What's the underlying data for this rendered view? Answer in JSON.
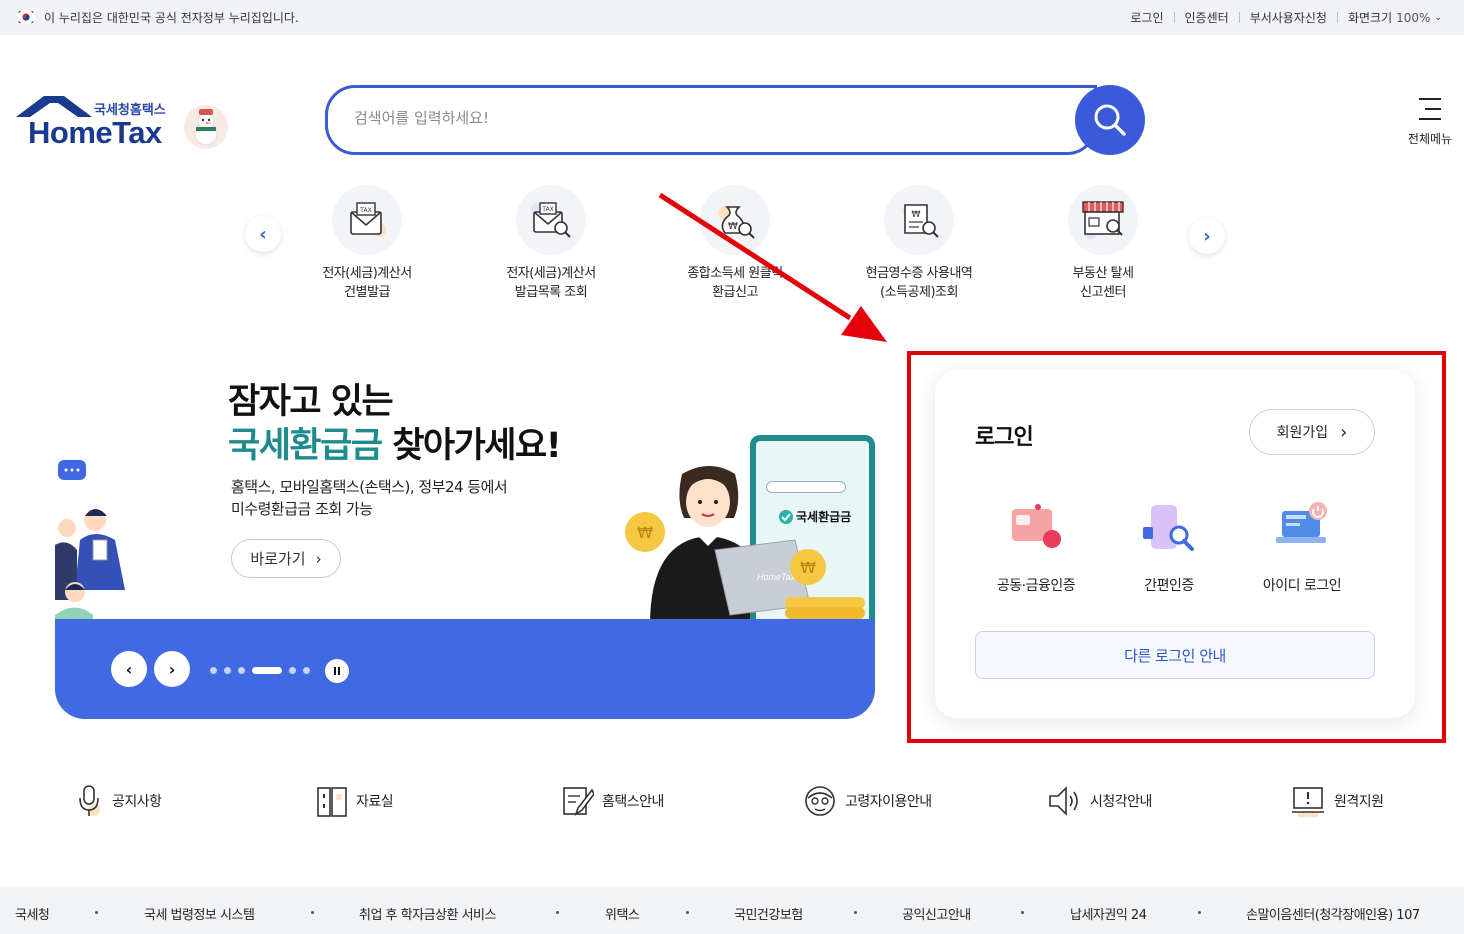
{
  "gov_bar": {
    "notice": "이 누리집은 대한민국 공식 전자정부 누리집입니다.",
    "links": [
      "로그인",
      "인증센터",
      "부서사용자신청"
    ],
    "zoom_label": "화면크기",
    "zoom_value": "100%"
  },
  "header": {
    "logo_sub": "국세청홈택스",
    "logo_main": "HomeTax",
    "search_placeholder": "검색어를 입력하세요!",
    "menu_label": "전체메뉴"
  },
  "quick_menu": {
    "items": [
      {
        "label": "전자(세금)계산서\n건별발급",
        "icon": "tax-invoice-envelope-icon"
      },
      {
        "label": "전자(세금)계산서\n발급목록 조회",
        "icon": "tax-invoice-search-icon"
      },
      {
        "label": "종합소득세 원클릭\n환급신고",
        "icon": "won-bag-search-icon"
      },
      {
        "label": "현금영수증 사용내역\n(소득공제)조회",
        "icon": "receipt-search-icon"
      },
      {
        "label": "부동산 탈세\n신고센터",
        "icon": "store-search-icon"
      }
    ]
  },
  "banner": {
    "title_line1": "잠자고 있는",
    "title_highlight": "국세환급금",
    "title_rest": " 찾아가세요!",
    "desc_line1": "홈택스, 모바일홈택스(손택스), 정부24 등에서",
    "desc_line2": "미수령환급금 조회 가능",
    "go_label": "바로가기",
    "card_label": "국세환급금",
    "slide_count": 6,
    "active_slide": 4,
    "accent": "#4169e1"
  },
  "login": {
    "title": "로그인",
    "signup_label": "회원가입",
    "options": [
      {
        "label": "공동·금융인증",
        "icon": "certificate-card-icon"
      },
      {
        "label": "간편인증",
        "icon": "phone-search-icon"
      },
      {
        "label": "아이디 로그인",
        "icon": "laptop-power-icon"
      }
    ],
    "other_label": "다른 로그인 안내",
    "highlight_color": "#e4020a"
  },
  "util_links": [
    {
      "label": "공지사항",
      "icon": "microphone-icon"
    },
    {
      "label": "자료실",
      "icon": "document-cabinet-icon"
    },
    {
      "label": "홈택스안내",
      "icon": "edit-document-icon"
    },
    {
      "label": "고령자이용안내",
      "icon": "senior-face-icon"
    },
    {
      "label": "시청각안내",
      "icon": "speaker-icon"
    },
    {
      "label": "원격지원",
      "icon": "remote-monitor-icon"
    }
  ],
  "footer_links": [
    "국세청",
    "국세 법령정보 시스템",
    "취업 후 학자금상환 서비스",
    "위택스",
    "국민건강보험",
    "공익신고안내",
    "납세자권익 24",
    "손말이음센터(청각장애인용) 107"
  ]
}
